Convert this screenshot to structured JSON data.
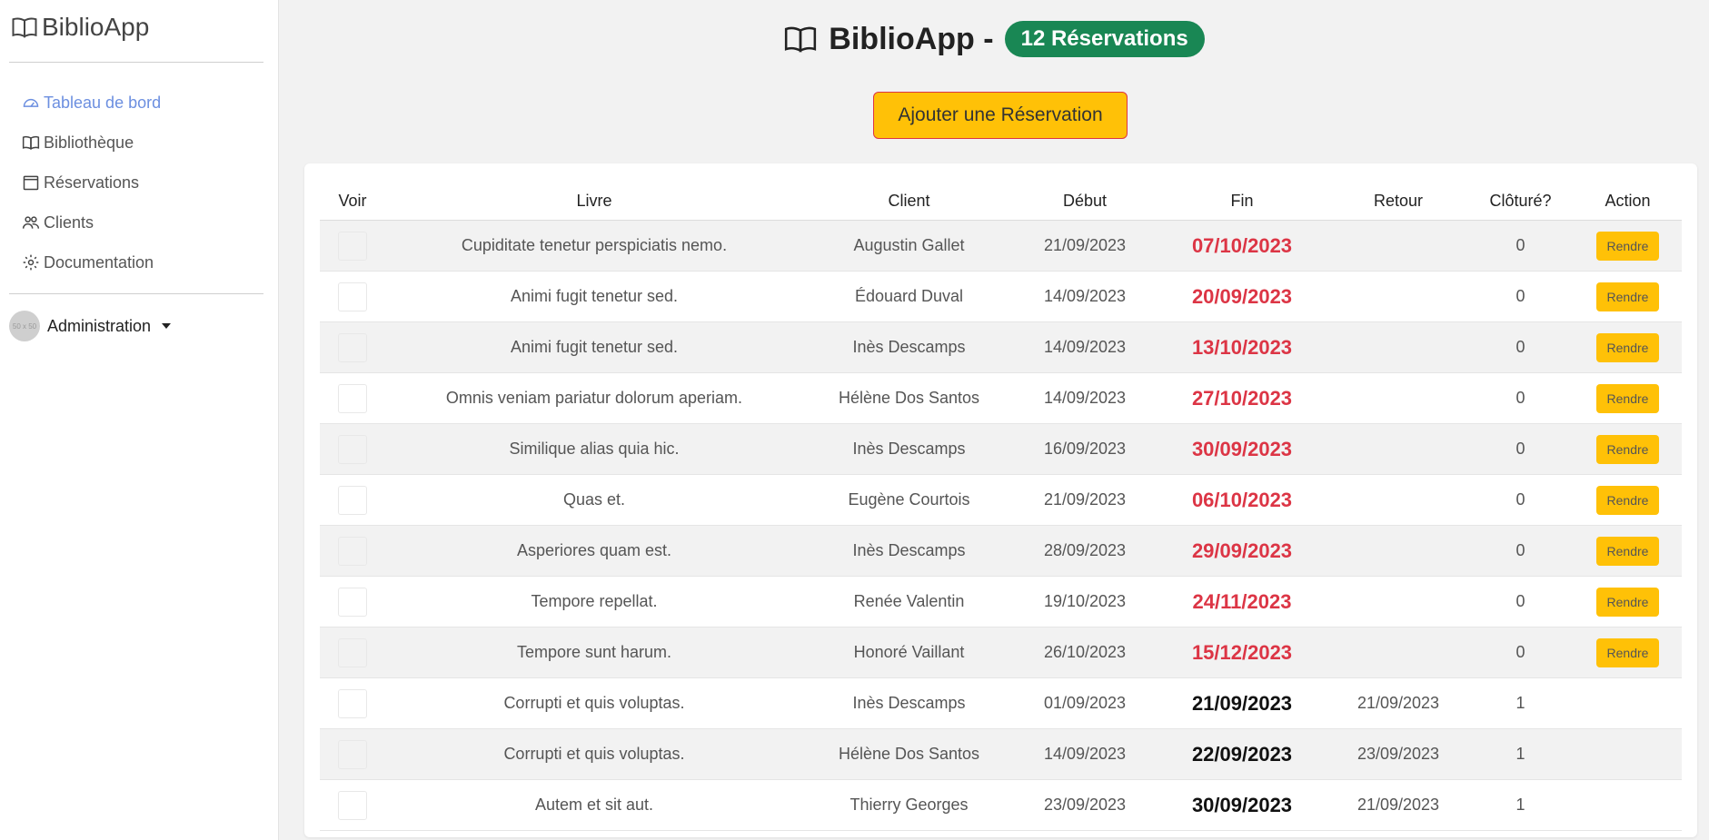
{
  "sidebar": {
    "brand": "BiblioApp",
    "items": [
      {
        "label": "Tableau de bord",
        "icon": "dashboard-icon",
        "active": true
      },
      {
        "label": "Bibliothèque",
        "icon": "book-icon"
      },
      {
        "label": "Réservations",
        "icon": "calendar-icon"
      },
      {
        "label": "Clients",
        "icon": "users-icon"
      },
      {
        "label": "Documentation",
        "icon": "gear-icon"
      }
    ],
    "user": {
      "avatar_text": "50 x 50",
      "label": "Administration"
    }
  },
  "header": {
    "title": "BiblioApp -",
    "badge": "12 Réservations",
    "add_button": "Ajouter une Réservation"
  },
  "table": {
    "columns": [
      "Voir",
      "Livre",
      "Client",
      "Début",
      "Fin",
      "Retour",
      "Clôturé?",
      "Action"
    ],
    "action_label": "Rendre",
    "rows": [
      {
        "livre": "Cupiditate tenetur perspiciatis nemo.",
        "client": "Augustin Gallet",
        "debut": "21/09/2023",
        "fin": "07/10/2023",
        "retour": "",
        "cloture": "0",
        "late": true
      },
      {
        "livre": "Animi fugit tenetur sed.",
        "client": "Édouard Duval",
        "debut": "14/09/2023",
        "fin": "20/09/2023",
        "retour": "",
        "cloture": "0",
        "late": true
      },
      {
        "livre": "Animi fugit tenetur sed.",
        "client": "Inès Descamps",
        "debut": "14/09/2023",
        "fin": "13/10/2023",
        "retour": "",
        "cloture": "0",
        "late": true
      },
      {
        "livre": "Omnis veniam pariatur dolorum aperiam.",
        "client": "Hélène Dos Santos",
        "debut": "14/09/2023",
        "fin": "27/10/2023",
        "retour": "",
        "cloture": "0",
        "late": true
      },
      {
        "livre": "Similique alias quia hic.",
        "client": "Inès Descamps",
        "debut": "16/09/2023",
        "fin": "30/09/2023",
        "retour": "",
        "cloture": "0",
        "late": true
      },
      {
        "livre": "Quas et.",
        "client": "Eugène Courtois",
        "debut": "21/09/2023",
        "fin": "06/10/2023",
        "retour": "",
        "cloture": "0",
        "late": true
      },
      {
        "livre": "Asperiores quam est.",
        "client": "Inès Descamps",
        "debut": "28/09/2023",
        "fin": "29/09/2023",
        "retour": "",
        "cloture": "0",
        "late": true
      },
      {
        "livre": "Tempore repellat.",
        "client": "Renée Valentin",
        "debut": "19/10/2023",
        "fin": "24/11/2023",
        "retour": "",
        "cloture": "0",
        "late": true
      },
      {
        "livre": "Tempore sunt harum.",
        "client": "Honoré Vaillant",
        "debut": "26/10/2023",
        "fin": "15/12/2023",
        "retour": "",
        "cloture": "0",
        "late": true
      },
      {
        "livre": "Corrupti et quis voluptas.",
        "client": "Inès Descamps",
        "debut": "01/09/2023",
        "fin": "21/09/2023",
        "retour": "21/09/2023",
        "cloture": "1",
        "late": false
      },
      {
        "livre": "Corrupti et quis voluptas.",
        "client": "Hélène Dos Santos",
        "debut": "14/09/2023",
        "fin": "22/09/2023",
        "retour": "23/09/2023",
        "cloture": "1",
        "late": false
      },
      {
        "livre": "Autem et sit aut.",
        "client": "Thierry Georges",
        "debut": "23/09/2023",
        "fin": "30/09/2023",
        "retour": "21/09/2023",
        "cloture": "1",
        "late": false
      }
    ]
  },
  "colors": {
    "accent": "#6c8fe0",
    "badge": "#198754",
    "warning": "#ffc107",
    "danger": "#dc3545"
  }
}
